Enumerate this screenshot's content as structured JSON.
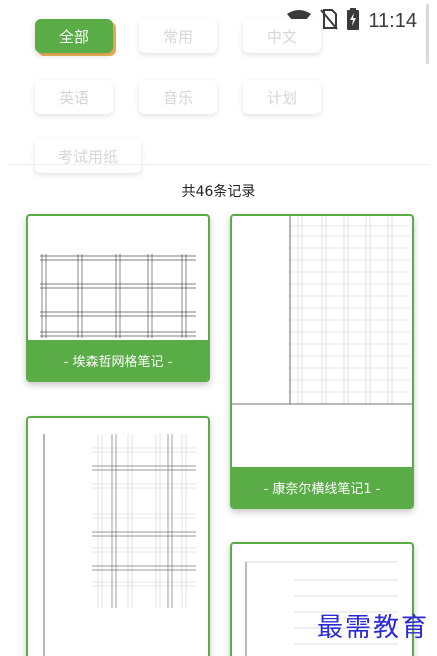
{
  "status_bar": {
    "time": "11:14",
    "icons": [
      "wifi-icon",
      "no-sim-icon",
      "battery-charging-icon"
    ]
  },
  "filters": [
    {
      "label": "全部",
      "active": true
    },
    {
      "label": "常用",
      "active": false
    },
    {
      "label": "中文",
      "active": false
    },
    {
      "label": "英语",
      "active": false
    },
    {
      "label": "音乐",
      "active": false
    },
    {
      "label": "计划",
      "active": false
    },
    {
      "label": "考试用纸",
      "active": false
    }
  ],
  "record_count": "共46条记录",
  "templates": [
    {
      "title": "- 埃森哲网格笔记 -"
    },
    {
      "title": "- 康奈尔横线笔记1 -"
    },
    {
      "title": ""
    },
    {
      "title": ""
    }
  ],
  "watermark": "最需教育",
  "colors": {
    "accent": "#5aac47",
    "active_chip_shadow": "#f0b35a",
    "watermark": "#2b2bd6"
  }
}
